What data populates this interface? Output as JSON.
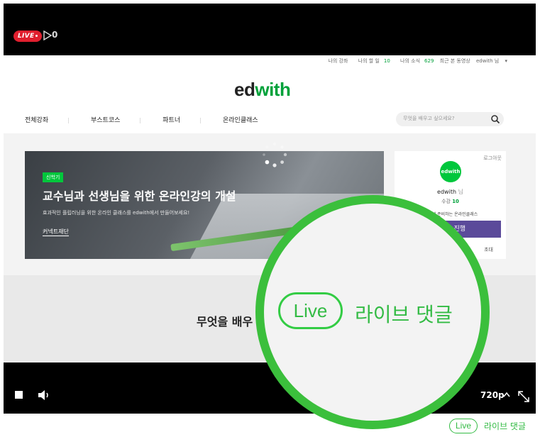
{
  "player": {
    "live_badge": "LIVE",
    "viewer_count": "0",
    "quality": "720p"
  },
  "site": {
    "utility": [
      "나의 강좌",
      "나의 할 일",
      "10",
      "나의 소식",
      "629",
      "최근 본 동영상",
      "edwith 님"
    ],
    "logo_ed": "ed",
    "logo_with": "with",
    "nav": [
      "전체강좌",
      "부스트코스",
      "파트너",
      "온라인클래스"
    ],
    "search_placeholder": "무엇을 배우고 싶으세요?",
    "banner": {
      "tag": "신학기",
      "title": "교수님과 선생님을 위한 온라인강의 개설",
      "subtitle": "효과적인 플립러닝을 위한 온라인 클래스를 edwith에서 만들어보세요!",
      "link": "커넥트재단"
    },
    "profile": {
      "logout": "로그아웃",
      "avatar": "edwith",
      "name": "edwith",
      "name_suffix": "님",
      "count_label": "수강",
      "count_value": "10",
      "desc": "나 쉽게 준비하는 온라인클래스",
      "button": "진행",
      "invite": "초대"
    },
    "section_title": "무엇을 배우"
  },
  "magnifier": {
    "pill": "Live",
    "label": "라이브 댓글"
  },
  "comment_bar": {
    "pill": "Live",
    "label": "라이브 댓글"
  },
  "colors": {
    "accent_green": "#33bb44",
    "live_red": "#e01f2e",
    "profile_button": "#5b4a9a"
  }
}
